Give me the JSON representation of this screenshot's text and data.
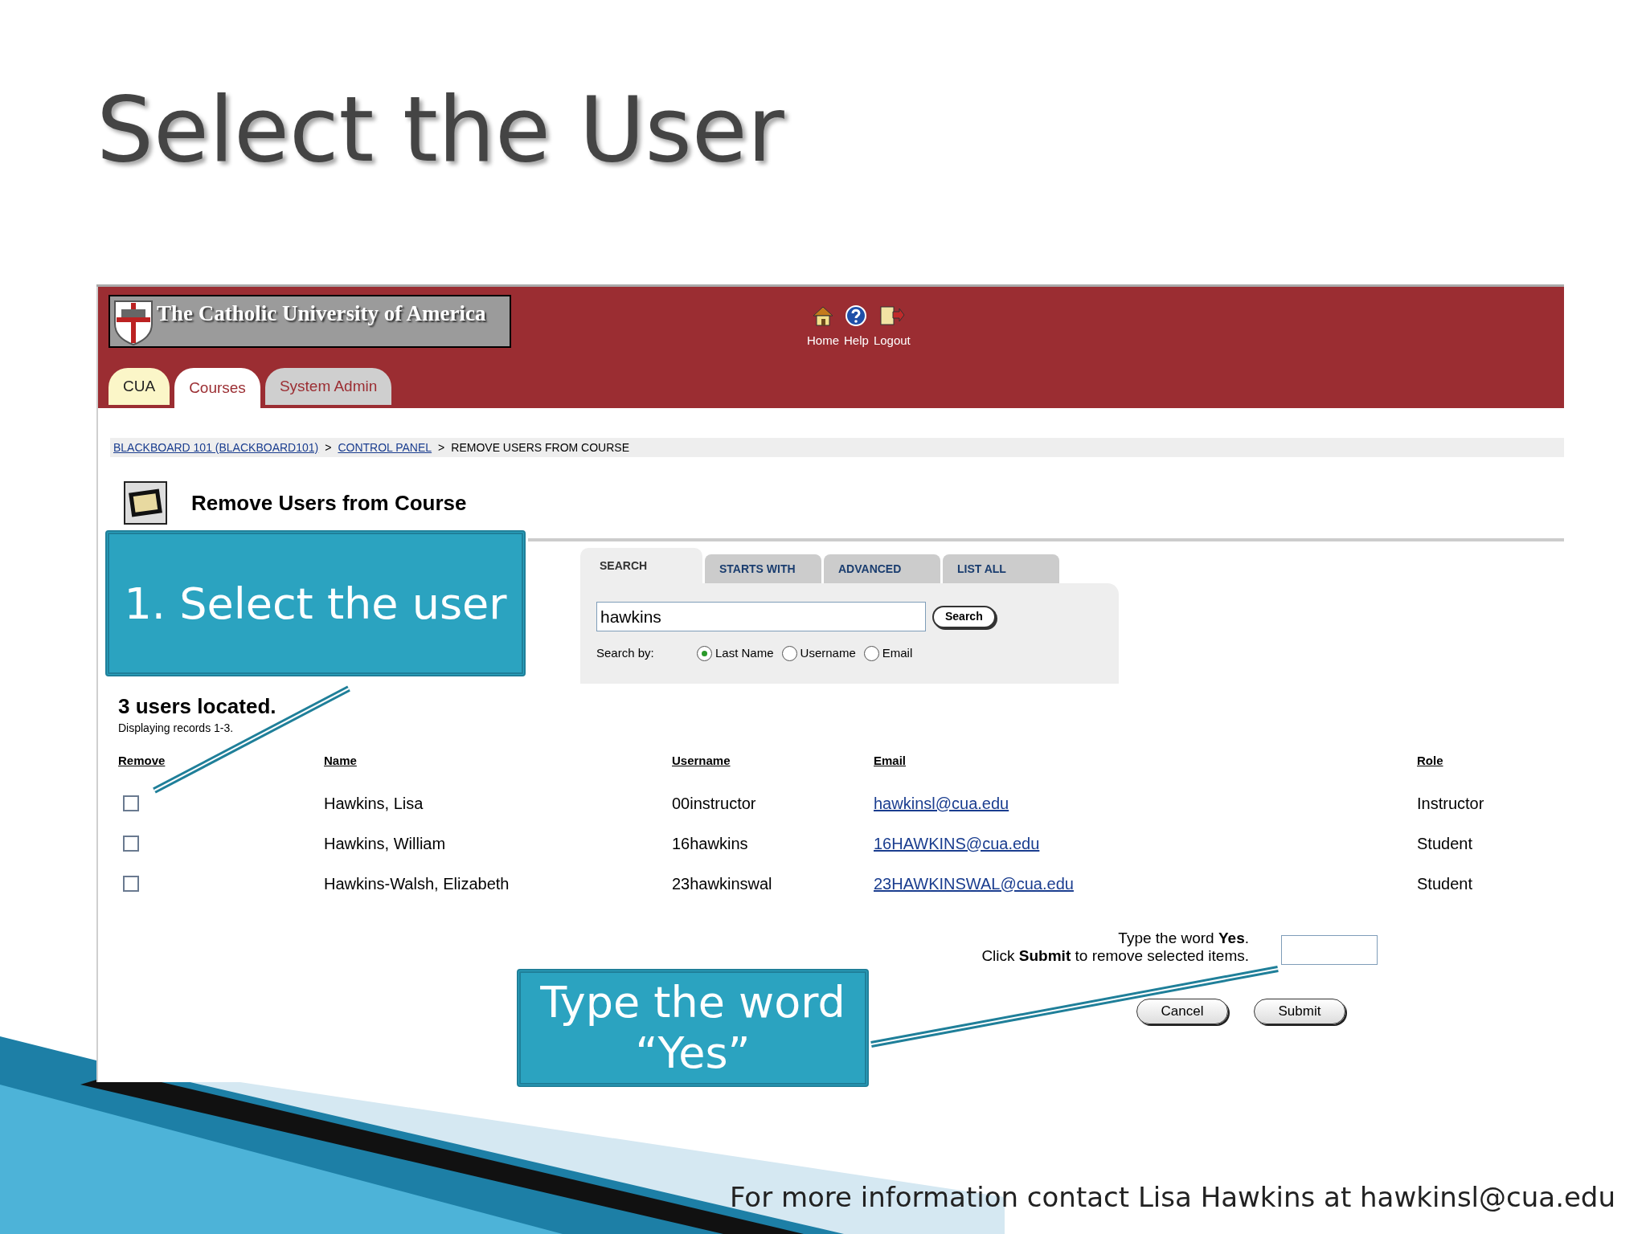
{
  "slide": {
    "title": "Select the User",
    "footer": "For more information contact Lisa Hawkins at hawkinsl@cua.edu"
  },
  "header": {
    "brand": "The Catholic University of America",
    "nav": [
      {
        "kind": "home",
        "label": "Home"
      },
      {
        "kind": "help",
        "label": "Help"
      },
      {
        "kind": "logout",
        "label": "Logout"
      }
    ],
    "tabs": [
      {
        "label": "CUA",
        "selected": false,
        "color": "#fbf6c8"
      },
      {
        "label": "Courses",
        "selected": true,
        "color": "#ffffff"
      },
      {
        "label": "System Admin",
        "selected": false,
        "color": "#cfcfcf"
      }
    ]
  },
  "breadcrumb": {
    "separator": ">",
    "items": [
      {
        "label": "BLACKBOARD 101 (BLACKBOARD101)",
        "link": true
      },
      {
        "label": "CONTROL PANEL",
        "link": true
      },
      {
        "label": "REMOVE USERS FROM COURSE",
        "link": false
      }
    ]
  },
  "page_title": "Remove Users from Course",
  "search": {
    "tabs": [
      {
        "label": "SEARCH",
        "selected": true
      },
      {
        "label": "STARTS WITH",
        "selected": false
      },
      {
        "label": "ADVANCED",
        "selected": false
      },
      {
        "label": "LIST ALL",
        "selected": false
      }
    ],
    "value": "hawkins",
    "button": "Search",
    "search_by_label": "Search by:",
    "options": [
      {
        "label": "Last Name",
        "selected": true
      },
      {
        "label": "Username",
        "selected": false
      },
      {
        "label": "Email",
        "selected": false
      }
    ]
  },
  "results": {
    "count": "3 users located.",
    "subtitle": "Displaying records 1-3.",
    "columns": [
      "Remove",
      "Name",
      "Username",
      "Email",
      "Role"
    ],
    "rows": [
      {
        "checked": false,
        "name": "Hawkins, Lisa",
        "username": "00instructor",
        "email": "hawkinsl@cua.edu",
        "role": "Instructor"
      },
      {
        "checked": false,
        "name": "Hawkins, William",
        "username": "16hawkins",
        "email": "16HAWKINS@cua.edu",
        "role": "Student"
      },
      {
        "checked": false,
        "name": "Hawkins-Walsh, Elizabeth",
        "username": "23hawkinswal",
        "email": "23HAWKINSWAL@cua.edu",
        "role": "Student"
      }
    ]
  },
  "confirm": {
    "prompt": "Type the word **Yes**.",
    "instruction": "Click **Submit** to remove selected items.",
    "buttons": [
      "Cancel",
      "Submit"
    ]
  },
  "callouts": [
    "1. Select the user",
    "Type the word “Yes”"
  ]
}
